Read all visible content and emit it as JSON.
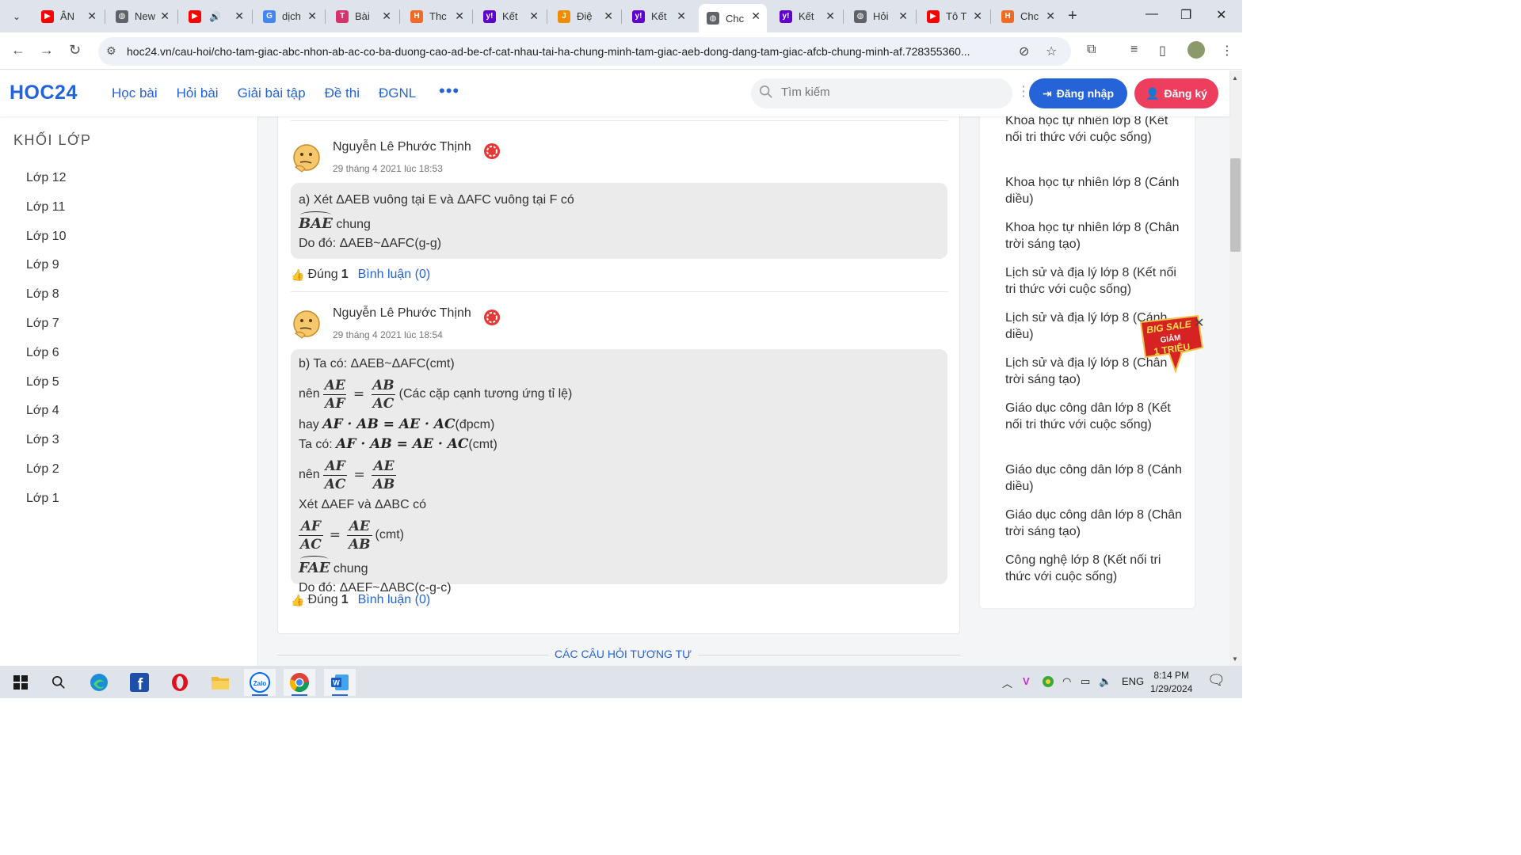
{
  "browser": {
    "tabs": [
      {
        "label": "ÂN",
        "icon": "youtube-icon",
        "color": "#ff0000"
      },
      {
        "label": "New",
        "icon": "globe-icon",
        "color": "#5f6368"
      },
      {
        "label": "",
        "icon": "youtube-icon",
        "color": "#ff0000"
      },
      {
        "label": "dịch",
        "icon": "google-icon",
        "color": "#4285f4"
      },
      {
        "label": "Bài",
        "icon": "t-icon",
        "color": "#d6336c"
      },
      {
        "label": "Thc",
        "icon": "hoc24-icon",
        "color": "#f46a24"
      },
      {
        "label": "Kết",
        "icon": "yahoo-icon",
        "color": "#6001d2"
      },
      {
        "label": "Điệ",
        "icon": "j-icon",
        "color": "#f08c00"
      },
      {
        "label": "Kết",
        "icon": "yahoo-icon",
        "color": "#6001d2"
      },
      {
        "label": "Chc",
        "icon": "globe-icon",
        "color": "#5f6368"
      },
      {
        "label": "Kết",
        "icon": "yahoo-icon",
        "color": "#6001d2"
      },
      {
        "label": "Hỏi",
        "icon": "globe-icon",
        "color": "#5f6368"
      },
      {
        "label": "Tô T",
        "icon": "youtube-icon",
        "color": "#ff0000"
      },
      {
        "label": "Chc",
        "icon": "hoc24-icon",
        "color": "#f46a24"
      }
    ],
    "url": "hoc24.vn/cau-hoi/cho-tam-giac-abc-nhon-ab-ac-co-ba-duong-cao-ad-be-cf-cat-nhau-tai-ha-chung-minh-tam-giac-aeb-dong-dang-tam-giac-afcb-chung-minh-af.728355360..."
  },
  "header": {
    "logo": "HOC24",
    "nav": [
      "Học bài",
      "Hỏi bài",
      "Giải bài tập",
      "Đề thi",
      "ĐGNL"
    ],
    "more": "•••",
    "search_placeholder": "Tìm kiếm",
    "login": "Đăng nhập",
    "register": "Đăng ký",
    "colors": {
      "primary": "#2563d9",
      "register": "#ee3e5e"
    }
  },
  "sidebar": {
    "title": "KHỐI LỚP",
    "grades": [
      "Lớp 12",
      "Lớp 11",
      "Lớp 10",
      "Lớp 9",
      "Lớp 8",
      "Lớp 7",
      "Lớp 6",
      "Lớp 5",
      "Lớp 4",
      "Lớp 3",
      "Lớp 2",
      "Lớp 1"
    ]
  },
  "answers": [
    {
      "author": "Nguyễn Lê Phước Thịnh",
      "time": "29 tháng 4 2021 lúc 18:53",
      "line1": "a) Xét ΔAEB vuông tại E và ΔAFC vuông tại F có",
      "angle": "BAE",
      "angle_suffix": " chung",
      "line3": "Do đó: ΔAEB~ΔAFC(g-g)",
      "likes_label": "Đúng",
      "likes": "1",
      "comments": "Bình luận (0)"
    },
    {
      "author": "Nguyễn Lê Phước Thịnh",
      "time": "29 tháng 4 2021 lúc 18:54",
      "l1": "b) Ta có: ΔAEB~ΔAFC(cmt)",
      "l2_pre": "nên",
      "l2_num1": "AE",
      "l2_den1": "AF",
      "l2_eq": "=",
      "l2_num2": "AB",
      "l2_den2": "AC",
      "l2_post": "(Các cặp cạnh tương ứng tỉ lệ)",
      "l3_pre": "hay ",
      "l3_math": "AF · AB = AE · AC",
      "l3_post": "(đpcm)",
      "l4_pre": "Ta có: ",
      "l4_math": "AF · AB = AE · AC",
      "l4_post": "(cmt)",
      "l5_pre": "nên",
      "l5_num1": "AF",
      "l5_den1": "AC",
      "l5_eq": "=",
      "l5_num2": "AE",
      "l5_den2": "AB",
      "l6": "Xét ΔAEF và ΔABC có",
      "l7_num1": "AF",
      "l7_den1": "AC",
      "l7_eq": "=",
      "l7_num2": "AE",
      "l7_den2": "AB",
      "l7_post": "(cmt)",
      "angle": "FAE",
      "angle_suffix": " chung",
      "l9": "Do đó: ΔAEF~ΔABC(c-g-c)",
      "likes_label": "Đúng",
      "likes": "1",
      "comments": "Bình luận (0)"
    }
  ],
  "similar_title": "CÁC CÂU HỎI TƯƠNG TỰ",
  "subjects": [
    "Khoa học tự nhiên lớp 8 (Kết nối tri thức với cuộc sống)",
    "Khoa học tự nhiên lớp 8 (Cánh diều)",
    "Khoa học tự nhiên lớp 8 (Chân trời sáng tạo)",
    "Lịch sử và địa lý lớp 8 (Kết nối tri thức với cuộc sống)",
    "Lịch sử và địa lý lớp 8 (Cánh diều)",
    "Lịch sử và địa lý lớp 8 (Chân trời sáng tạo)",
    "Giáo dục công dân lớp 8 (Kết nối tri thức với cuộc sống)",
    "Giáo dục công dân lớp 8 (Cánh diều)",
    "Giáo dục công dân lớp 8 (Chân trời sáng tạo)",
    "Công nghệ lớp 8 (Kết nối tri thức với cuộc sống)"
  ],
  "promo": {
    "line1": "BIG SALE",
    "line2": "GIẢM",
    "line3": "1 TRIỆU"
  },
  "taskbar": {
    "language": "ENG",
    "time": "8:14 PM",
    "date": "1/29/2024"
  }
}
